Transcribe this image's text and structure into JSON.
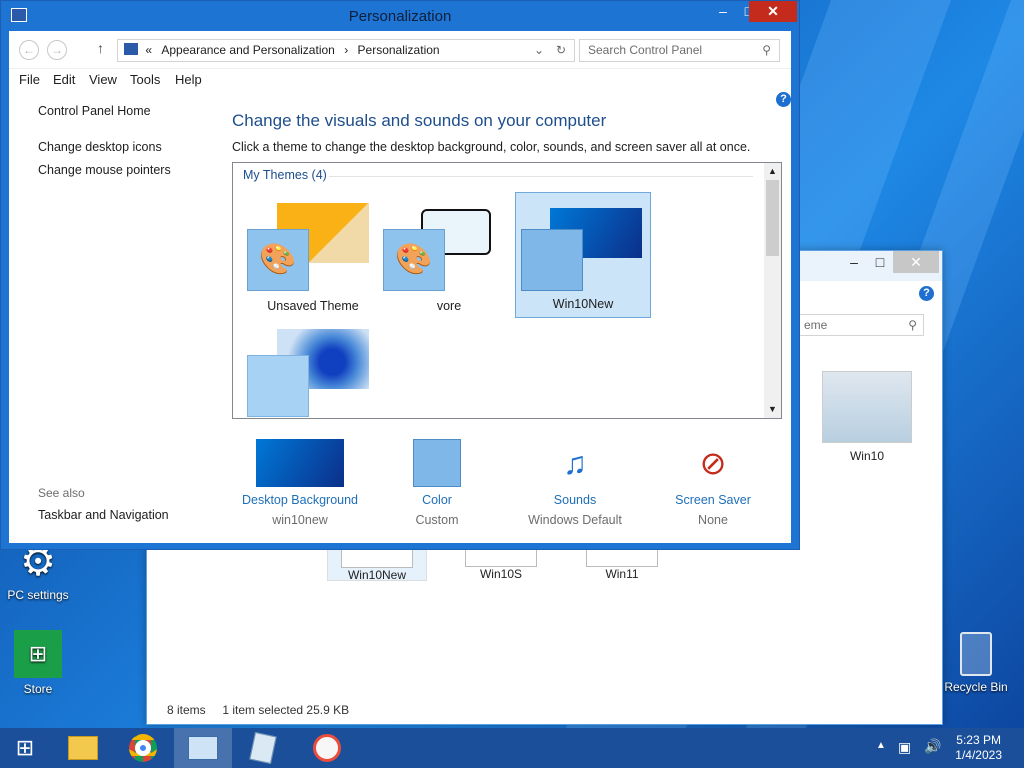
{
  "window": {
    "title": "Personalization"
  },
  "nav": {
    "breadcrumb_prefix": "«",
    "breadcrumbs": [
      "Appearance and Personalization",
      "Personalization"
    ],
    "search_placeholder": "Search Control Panel"
  },
  "menu": [
    "File",
    "Edit",
    "View",
    "Tools",
    "Help"
  ],
  "left_pane": {
    "home": "Control Panel Home",
    "links": [
      "Change desktop icons",
      "Change mouse pointers"
    ],
    "see_also": "See also",
    "see_also_links": [
      "Taskbar and Navigation"
    ]
  },
  "main": {
    "heading": "Change the visuals and sounds on your computer",
    "subheading": "Click a theme to change the desktop background, color, sounds, and screen saver all at once.",
    "section": "My Themes (4)",
    "themes": [
      {
        "name": "Unsaved Theme"
      },
      {
        "name": "vore"
      },
      {
        "name": "Win10New",
        "selected": true
      },
      {
        "name": ""
      }
    ]
  },
  "options": [
    {
      "title": "Desktop Background",
      "value": "win10new"
    },
    {
      "title": "Color",
      "value": "Custom"
    },
    {
      "title": "Sounds",
      "value": "Windows Default"
    },
    {
      "title": "Screen Saver",
      "value": "None"
    }
  ],
  "explorer": {
    "search_fragment": "eme",
    "status_items": "8 items",
    "status_selection": "1 item selected  25.9 KB",
    "files": [
      "Win10",
      "Win10New",
      "Win10S",
      "Win11"
    ]
  },
  "desktop_icons": [
    "PC settings",
    "Store",
    "Recycle Bin"
  ],
  "taskbar": {
    "time": "5:23 PM",
    "date": "1/4/2023"
  },
  "colors": {
    "accent": "#1e74d3",
    "link": "#1e6fb8",
    "heading": "#1e4e8c",
    "close": "#c42b1c"
  }
}
